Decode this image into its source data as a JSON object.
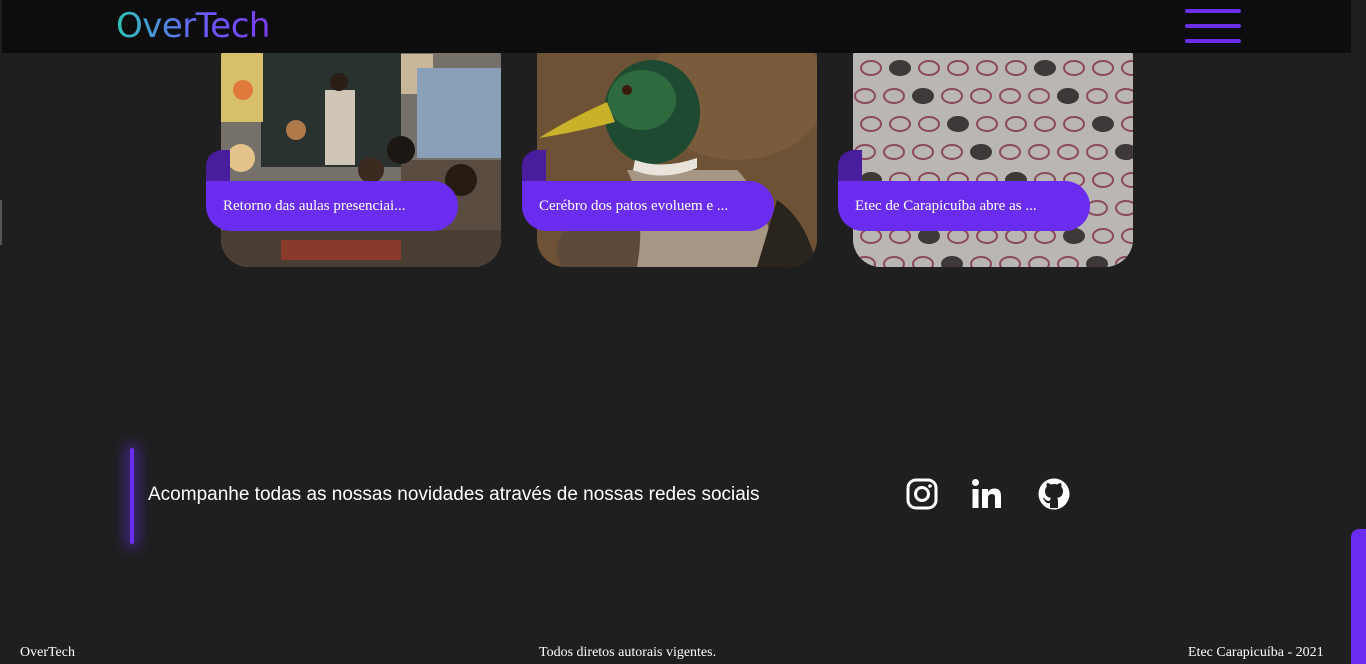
{
  "header": {
    "logo": "OverTech",
    "menu_icon": "hamburger-menu-icon"
  },
  "news": {
    "cards": [
      {
        "label": "Retorno das aulas presenciai...",
        "image": "classroom-photo"
      },
      {
        "label": "Cerébro dos patos evoluem e ...",
        "image": "duck-photo"
      },
      {
        "label": "Etec de Carapicuíba abre as ...",
        "image": "answer-sheet-photo"
      }
    ]
  },
  "social": {
    "text": "Acompanhe todas as nossas novidades através de nossas redes sociais",
    "icons": [
      "instagram-icon",
      "linkedin-icon",
      "github-icon"
    ]
  },
  "footer": {
    "left": "OverTech",
    "center": "Todos diretos autorais vigentes.",
    "right": "Etec Carapicuíba - 2021"
  },
  "colors": {
    "accent": "#6a2df0",
    "background": "#1f1f1f",
    "header": "#0d0d0d"
  }
}
